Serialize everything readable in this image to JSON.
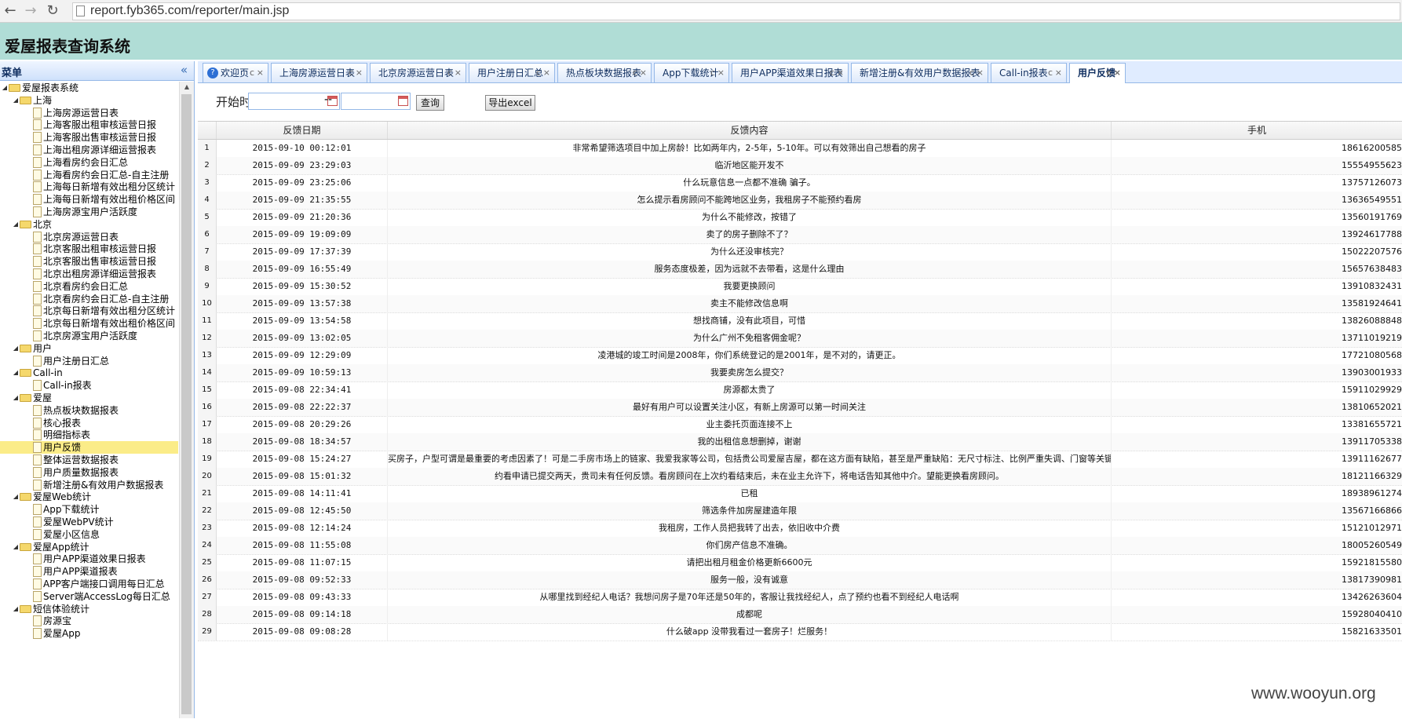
{
  "browser": {
    "url": "report.fyb365.com/reporter/main.jsp"
  },
  "app": {
    "title": "爱屋报表查询系统"
  },
  "sidebar": {
    "title": "菜单",
    "tree": [
      {
        "label": "爱屋报表系统",
        "type": "folder"
      },
      {
        "label": "上海",
        "type": "folder"
      },
      {
        "label": "上海房源运营日表",
        "type": "leaf"
      },
      {
        "label": "上海客服出租审核运营日报",
        "type": "leaf"
      },
      {
        "label": "上海客服出售审核运营日报",
        "type": "leaf"
      },
      {
        "label": "上海出租房源详细运营报表",
        "type": "leaf"
      },
      {
        "label": "上海看房约会日汇总",
        "type": "leaf"
      },
      {
        "label": "上海看房约会日汇总-自主注册",
        "type": "leaf"
      },
      {
        "label": "上海每日新增有效出租分区统计",
        "type": "leaf"
      },
      {
        "label": "上海每日新增有效出租价格区间",
        "type": "leaf"
      },
      {
        "label": "上海房源宝用户活跃度",
        "type": "leaf"
      },
      {
        "label": "北京",
        "type": "folder"
      },
      {
        "label": "北京房源运营日表",
        "type": "leaf"
      },
      {
        "label": "北京客服出租审核运营日报",
        "type": "leaf"
      },
      {
        "label": "北京客服出售审核运营日报",
        "type": "leaf"
      },
      {
        "label": "北京出租房源详细运营报表",
        "type": "leaf"
      },
      {
        "label": "北京看房约会日汇总",
        "type": "leaf"
      },
      {
        "label": "北京看房约会日汇总-自主注册",
        "type": "leaf"
      },
      {
        "label": "北京每日新增有效出租分区统计",
        "type": "leaf"
      },
      {
        "label": "北京每日新增有效出租价格区间",
        "type": "leaf"
      },
      {
        "label": "北京房源宝用户活跃度",
        "type": "leaf"
      },
      {
        "label": "用户",
        "type": "folder"
      },
      {
        "label": "用户注册日汇总",
        "type": "leaf"
      },
      {
        "label": "Call-in",
        "type": "folder"
      },
      {
        "label": "Call-in报表",
        "type": "leaf"
      },
      {
        "label": "爱屋",
        "type": "folder"
      },
      {
        "label": "热点板块数据报表",
        "type": "leaf"
      },
      {
        "label": "核心报表",
        "type": "leaf"
      },
      {
        "label": "明细指标表",
        "type": "leaf"
      },
      {
        "label": "用户反馈",
        "type": "leaf",
        "selected": true
      },
      {
        "label": "整体运营数据报表",
        "type": "leaf"
      },
      {
        "label": "用户质量数据报表",
        "type": "leaf"
      },
      {
        "label": "新增注册&有效用户数据报表",
        "type": "leaf"
      },
      {
        "label": "爱屋Web统计",
        "type": "folder"
      },
      {
        "label": "App下载统计",
        "type": "leaf"
      },
      {
        "label": "爱屋WebPV统计",
        "type": "leaf"
      },
      {
        "label": "爱屋小区信息",
        "type": "leaf"
      },
      {
        "label": "爱屋App统计",
        "type": "folder"
      },
      {
        "label": "用户APP渠道效果日报表",
        "type": "leaf"
      },
      {
        "label": "用户APP渠道报表",
        "type": "leaf"
      },
      {
        "label": "APP客户端接口调用每日汇总",
        "type": "leaf"
      },
      {
        "label": "Server端AccessLog每日汇总",
        "type": "leaf"
      },
      {
        "label": "短信体验统计",
        "type": "folder"
      },
      {
        "label": "房源宝",
        "type": "leaf"
      },
      {
        "label": "爱屋App",
        "type": "leaf"
      }
    ]
  },
  "tabs": [
    {
      "label": "欢迎页"
    },
    {
      "label": "上海房源运营日表"
    },
    {
      "label": "北京房源运营日表"
    },
    {
      "label": "用户注册日汇总"
    },
    {
      "label": "热点板块数据报表"
    },
    {
      "label": "App下载统计"
    },
    {
      "label": "用户APP渠道效果日报表"
    },
    {
      "label": "新增注册&有效用户数据报表"
    },
    {
      "label": "Call-in报表"
    },
    {
      "label": "用户反馈",
      "active": true
    }
  ],
  "tab_refresh_glyph": "c",
  "tab_close_glyph": "×",
  "search": {
    "start_label": "开始时间：",
    "separator": "--",
    "start_value": "",
    "end_value": "",
    "query_button": "查询",
    "export_button": "导出excel"
  },
  "grid": {
    "headers": [
      "反馈日期",
      "反馈内容",
      "手机"
    ],
    "rows": [
      {
        "n": "1",
        "date": "2015-09-10 00:12:01",
        "content": "非常希望筛选项目中加上房龄！比如两年内，2-5年，5-10年。可以有效筛出自己想看的房子",
        "phone": "18616200585"
      },
      {
        "n": "2",
        "date": "2015-09-09 23:29:03",
        "content": "临沂地区能开发不",
        "phone": "15554955623"
      },
      {
        "n": "3",
        "date": "2015-09-09 23:25:06",
        "content": "什么玩意信息一点都不准确 骗子。",
        "phone": "13757126073"
      },
      {
        "n": "4",
        "date": "2015-09-09 21:35:55",
        "content": "怎么提示看房顾问不能跨地区业务，我租房子不能预约看房",
        "phone": "13636549551"
      },
      {
        "n": "5",
        "date": "2015-09-09 21:20:36",
        "content": "为什么不能修改，按错了",
        "phone": "13560191769"
      },
      {
        "n": "6",
        "date": "2015-09-09 19:09:09",
        "content": "卖了的房子删除不了？",
        "phone": "13924617788"
      },
      {
        "n": "7",
        "date": "2015-09-09 17:37:39",
        "content": "为什么还没审核完？",
        "phone": "15022207576"
      },
      {
        "n": "8",
        "date": "2015-09-09 16:55:49",
        "content": "服务态度极差，因为远就不去带看，这是什么理由",
        "phone": "15657638483"
      },
      {
        "n": "9",
        "date": "2015-09-09 15:30:52",
        "content": "我要更换顾问",
        "phone": "13910832431"
      },
      {
        "n": "10",
        "date": "2015-09-09 13:57:38",
        "content": "卖主不能修改信息啊",
        "phone": "13581924641"
      },
      {
        "n": "11",
        "date": "2015-09-09 13:54:58",
        "content": "想找商铺，没有此项目，可惜",
        "phone": "13826088848"
      },
      {
        "n": "12",
        "date": "2015-09-09 13:02:05",
        "content": "为什么广州不免租客佣金呢？",
        "phone": "13711019219"
      },
      {
        "n": "13",
        "date": "2015-09-09 12:29:09",
        "content": "凌港城的竣工时间是2008年，你们系统登记的是2001年，是不对的，请更正。",
        "phone": "17721080568"
      },
      {
        "n": "14",
        "date": "2015-09-09 10:59:13",
        "content": "我要卖房怎么提交？",
        "phone": "13903001933"
      },
      {
        "n": "15",
        "date": "2015-09-08 22:34:41",
        "content": "房源都太贵了",
        "phone": "15911029929"
      },
      {
        "n": "16",
        "date": "2015-09-08 22:22:37",
        "content": "最好有用户可以设置关注小区，有新上房源可以第一时间关注",
        "phone": "13810652021"
      },
      {
        "n": "17",
        "date": "2015-09-08 20:29:26",
        "content": "业主委托页面连接不上",
        "phone": "13381655721"
      },
      {
        "n": "18",
        "date": "2015-09-08 18:34:57",
        "content": "我的出租信息想删掉，谢谢",
        "phone": "13911705338"
      },
      {
        "n": "19",
        "date": "2015-09-08 15:24:27",
        "content": "买房子，户型可谓是最重要的考虑因素了！可是二手房市场上的链家、我爱我家等公司，包括贵公司爱屋吉屋，都在这方面有缺陷，甚至是严重缺陷：无尺寸标注、比例严重失调、门窗等关键性",
        "phone": "13911162677"
      },
      {
        "n": "20",
        "date": "2015-09-08 15:01:32",
        "content": "约看申请已提交两天，贵司未有任何反馈。看房顾问在上次约看结束后，未在业主允许下，将电话告知其他中介。望能更换看房顾问。",
        "phone": "18121166329"
      },
      {
        "n": "21",
        "date": "2015-09-08 14:11:41",
        "content": "已租",
        "phone": "18938961274"
      },
      {
        "n": "22",
        "date": "2015-09-08 12:45:50",
        "content": "筛选条件加房屋建造年限",
        "phone": "13567166866"
      },
      {
        "n": "23",
        "date": "2015-09-08 12:14:24",
        "content": "我租房，工作人员把我转了出去，依旧收中介费",
        "phone": "15121012971"
      },
      {
        "n": "24",
        "date": "2015-09-08 11:55:08",
        "content": "你们房产信息不准确。",
        "phone": "18005260549"
      },
      {
        "n": "25",
        "date": "2015-09-08 11:07:15",
        "content": "请把出租月租金价格更新6600元",
        "phone": "15921815580"
      },
      {
        "n": "26",
        "date": "2015-09-08 09:52:33",
        "content": "服务一般，没有诚意",
        "phone": "13817390981"
      },
      {
        "n": "27",
        "date": "2015-09-08 09:43:33",
        "content": "从哪里找到经纪人电话？我想问房子是70年还是50年的，客服让我找经纪人，点了预约也看不到经纪人电话啊",
        "phone": "13426263604"
      },
      {
        "n": "28",
        "date": "2015-09-08 09:14:18",
        "content": "成都呢",
        "phone": "15928040410"
      },
      {
        "n": "29",
        "date": "2015-09-08 09:08:28",
        "content": "什么破app 没带我看过一套房子！烂服务！",
        "phone": "15821633501"
      }
    ]
  },
  "watermark": "www.wooyun.org"
}
